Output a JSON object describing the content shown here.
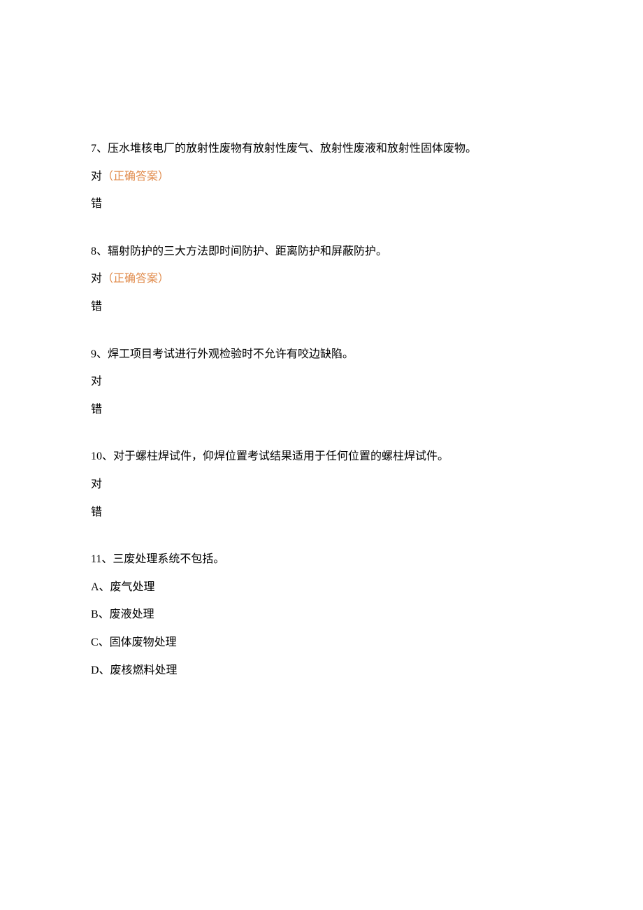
{
  "correct_label": "（正确答案）",
  "questions": [
    {
      "number": "7、",
      "text": "压水堆核电厂的放射性废物有放射性废气、放射性废液和放射性固体废物。",
      "options": [
        {
          "label": "对",
          "correct": true
        },
        {
          "label": "错",
          "correct": false
        }
      ]
    },
    {
      "number": "8、",
      "text": "辐射防护的三大方法即时间防护、距离防护和屏蔽防护。",
      "options": [
        {
          "label": "对",
          "correct": true
        },
        {
          "label": "错",
          "correct": false
        }
      ]
    },
    {
      "number": "9、",
      "text": "焊工项目考试进行外观检验时不允许有咬边缺陷。",
      "options": [
        {
          "label": "对",
          "correct": false
        },
        {
          "label": "错",
          "correct": false
        }
      ]
    },
    {
      "number": "10、",
      "text": "对于螺柱焊试件，仰焊位置考试结果适用于任何位置的螺柱焊试件。",
      "options": [
        {
          "label": "对",
          "correct": false
        },
        {
          "label": "错",
          "correct": false
        }
      ]
    },
    {
      "number": "11、",
      "text": "三废处理系统不包括。",
      "options": [
        {
          "label": "A、废气处理",
          "correct": false
        },
        {
          "label": "B、废液处理",
          "correct": false
        },
        {
          "label": "C、固体废物处理",
          "correct": false
        },
        {
          "label": "D、废核燃料处理",
          "correct": false
        }
      ]
    }
  ]
}
